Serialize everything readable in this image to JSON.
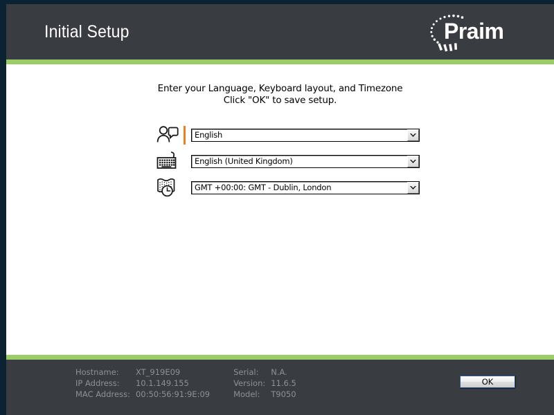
{
  "header": {
    "title": "Initial Setup",
    "logo_text": "Praim",
    "logo_icon": "praim-swoosh-logo"
  },
  "colors": {
    "accent_green": "#9ccc68",
    "header_bg": "#393c41",
    "frame_navy": "#0b2233",
    "icon_orange": "#e8821e",
    "footer_text": "#8d9197"
  },
  "main": {
    "instruction_line1": "Enter your Language, Keyboard layout, and Timezone",
    "instruction_line2": "Click \"OK\" to save setup.",
    "fields": [
      {
        "name": "language",
        "icon": "person-speech-icon",
        "value": "English"
      },
      {
        "name": "keyboard-layout",
        "icon": "keyboard-icon",
        "value": "English (United Kingdom)"
      },
      {
        "name": "timezone",
        "icon": "world-clock-icon",
        "value": "GMT +00:00: GMT - Dublin, London"
      }
    ]
  },
  "footer": {
    "columns": [
      {
        "labels": [
          "Hostname:",
          "IP Address:",
          "MAC Address:"
        ],
        "values": [
          "XT_919E09",
          "10.1.149.155",
          "00:50:56:91:9E:09"
        ]
      },
      {
        "labels": [
          "Serial:",
          "Version:",
          "Model:"
        ],
        "values": [
          "N.A.",
          "11.6.5",
          "T9050"
        ]
      }
    ],
    "ok_label": "OK"
  }
}
